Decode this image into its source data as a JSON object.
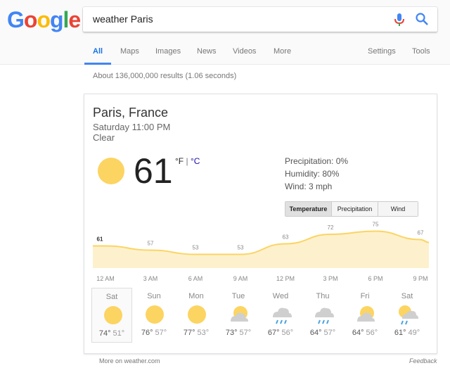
{
  "logo": {
    "letters": [
      "G",
      "o",
      "o",
      "g",
      "l",
      "e"
    ],
    "colors": [
      "#4285f4",
      "#ea4335",
      "#fbbc05",
      "#4285f4",
      "#34a853",
      "#ea4335"
    ]
  },
  "search": {
    "value": "weather Paris"
  },
  "tabs": [
    {
      "label": "All",
      "active": true
    },
    {
      "label": "Maps"
    },
    {
      "label": "Images"
    },
    {
      "label": "News"
    },
    {
      "label": "Videos"
    },
    {
      "label": "More"
    },
    {
      "label": "Settings"
    },
    {
      "label": "Tools"
    }
  ],
  "stats": "About 136,000,000 results (1.06 seconds)",
  "weather": {
    "location": "Paris, France",
    "time": "Saturday 11:00 PM",
    "condition": "Clear",
    "temp": "61",
    "unit_f": "°F",
    "unit_sep": " | ",
    "unit_c": "°C",
    "precipitation": "Precipitation: 0%",
    "humidity": "Humidity: 80%",
    "wind": "Wind: 3 mph",
    "toggles": [
      "Temperature",
      "Precipitation",
      "Wind"
    ]
  },
  "chart_data": {
    "type": "area",
    "categories": [
      "12 AM",
      "3 AM",
      "6 AM",
      "9 AM",
      "12 PM",
      "3 PM",
      "6 PM",
      "9 PM"
    ],
    "values": [
      61,
      57,
      53,
      53,
      63,
      72,
      75,
      67
    ],
    "ylim": [
      40,
      80
    ],
    "color": "#fcd462"
  },
  "forecast": [
    {
      "day": "Sat",
      "icon": "sun-icon",
      "high": "74°",
      "low": "51°"
    },
    {
      "day": "Sun",
      "icon": "sun-icon",
      "high": "76°",
      "low": "57°"
    },
    {
      "day": "Mon",
      "icon": "sun-icon",
      "high": "77°",
      "low": "53°"
    },
    {
      "day": "Tue",
      "icon": "partly-cloudy-icon",
      "high": "73°",
      "low": "57°"
    },
    {
      "day": "Wed",
      "icon": "rain-icon",
      "high": "67°",
      "low": "56°"
    },
    {
      "day": "Thu",
      "icon": "rain-icon",
      "high": "64°",
      "low": "57°"
    },
    {
      "day": "Fri",
      "icon": "partly-cloudy-icon",
      "high": "64°",
      "low": "56°"
    },
    {
      "day": "Sat",
      "icon": "rain-sun-icon",
      "high": "61°",
      "low": "49°"
    }
  ],
  "footer": {
    "left": "More on weather.com",
    "right": "Feedback"
  }
}
